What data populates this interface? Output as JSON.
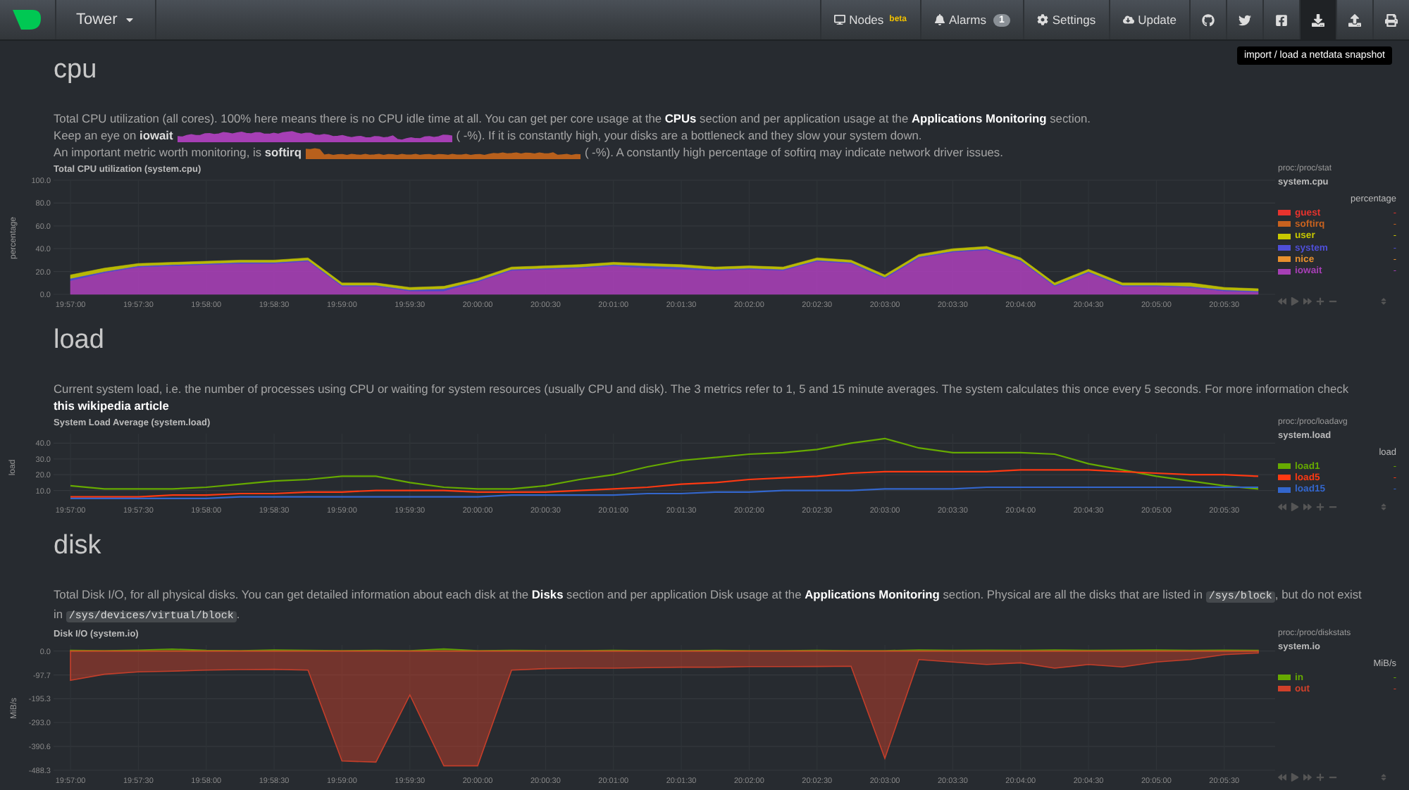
{
  "nav": {
    "host": "Tower",
    "items": [
      {
        "kind": "text",
        "label": "Nodes",
        "sup": "beta",
        "selected": false
      },
      {
        "kind": "text",
        "label": "Alarms",
        "count": "1",
        "selected": false
      },
      {
        "kind": "text",
        "label": "Settings",
        "selected": false
      },
      {
        "kind": "text",
        "label": "Update",
        "selected": false
      },
      {
        "kind": "icon",
        "selected": false
      },
      {
        "kind": "icon",
        "selected": false
      },
      {
        "kind": "icon",
        "selected": false
      },
      {
        "kind": "icon",
        "selected": true
      },
      {
        "kind": "icon",
        "selected": false
      },
      {
        "kind": "icon",
        "selected": false
      }
    ],
    "tooltip": "import / load a netdata snapshot"
  },
  "sections": [
    {
      "heading": "cpu",
      "description": [
        [
          {
            "kind": "text",
            "text": "Total CPU utilization (all cores). 100% here means there is no CPU idle time at all. You can get per core usage at the "
          },
          {
            "kind": "link",
            "text": "CPUs"
          },
          {
            "kind": "text",
            "text": " section and per application usage at the "
          },
          {
            "kind": "link",
            "text": "Applications Monitoring"
          },
          {
            "kind": "text",
            "text": " section."
          }
        ],
        [
          {
            "kind": "text",
            "text": "Keep an eye on **iowait**"
          },
          {
            "kind": "sparkline",
            "color": "#a63fb5"
          },
          {
            "kind": "text",
            "text": "( -%). If it is constantly high, your disks are a bottleneck and they slow your system down."
          }
        ],
        [
          {
            "kind": "text",
            "text": "An important metric worth monitoring, is **softirq**"
          },
          {
            "kind": "sparkline",
            "color": "#b8601c"
          },
          {
            "kind": "text",
            "text": "( -%). A constantly high percentage of softirq may indicate network driver issues."
          }
        ]
      ],
      "legend": {
        "source": "proc:/proc/stat",
        "context": "system.cpu",
        "units": "percentage",
        "values": [
          "-",
          "-",
          "-",
          "-",
          "-",
          "-"
        ]
      },
      "chart_data": {
        "type": "area",
        "stacked": true,
        "grid": true,
        "title": "Total CPU utilization (system.cpu)",
        "ylabel": "percentage",
        "categories": [
          "19:57:00",
          null,
          "19:57:30",
          null,
          "19:58:00",
          null,
          "19:58:30",
          null,
          "19:59:00",
          null,
          "19:59:30",
          null,
          "20:00:00",
          null,
          "20:00:30",
          null,
          "20:01:00",
          null,
          "20:01:30",
          null,
          "20:02:00",
          null,
          "20:02:30",
          null,
          "20:03:00",
          null,
          "20:03:30",
          null,
          "20:04:00",
          null,
          "20:04:30",
          null,
          "20:05:00",
          null,
          "20:05:30",
          null
        ],
        "ylim": [
          0,
          100
        ],
        "yticks": [
          {
            "value": 0,
            "label": "0.0"
          },
          {
            "value": 20,
            "label": "20.0"
          },
          {
            "value": 40,
            "label": "40.0"
          },
          {
            "value": 60,
            "label": "60.0"
          },
          {
            "value": 80,
            "label": "80.0"
          },
          {
            "value": 100,
            "label": "100.0"
          }
        ],
        "series": [
          {
            "name": "iowait",
            "color": "#a63fb5",
            "values": [
              12,
              19,
              24,
              25,
              26,
              27,
              27,
              29,
              7,
              7,
              3,
              3,
              11,
              21,
              22,
              23,
              25,
              23,
              22,
              21,
              22,
              21,
              29,
              27,
              14,
              32,
              37,
              39,
              29,
              7,
              19,
              7,
              7,
              6,
              3,
              2
            ]
          },
          {
            "name": "nice",
            "color": "#e8902d",
            "values": [
              null,
              null,
              null,
              null,
              null,
              null,
              null,
              null,
              null,
              null,
              null,
              null,
              null,
              null,
              null,
              null,
              null,
              null,
              null,
              null,
              null,
              null,
              null,
              null,
              null,
              null,
              null,
              null,
              null,
              null,
              null,
              null,
              null,
              null,
              null,
              null
            ]
          },
          {
            "name": "system",
            "color": "#4f4fd8",
            "values": [
              2,
              1,
              1,
              1,
              1,
              1,
              1,
              1,
              1,
              1,
              1,
              2,
              1,
              1,
              1,
              1,
              1,
              2,
              2,
              1,
              1,
              1,
              1,
              1,
              1,
              1,
              1,
              1,
              1,
              1,
              1,
              1,
              1,
              1,
              1,
              1
            ]
          },
          {
            "name": "user",
            "color": "#c8c800",
            "values": [
              3,
              3,
              2,
              2,
              2,
              2,
              2,
              2,
              2,
              2,
              2,
              2,
              2,
              2,
              2,
              2,
              2,
              2,
              2,
              2,
              2,
              2,
              2,
              2,
              2,
              2,
              2,
              2,
              2,
              2,
              2,
              2,
              2,
              3,
              2,
              2
            ]
          },
          {
            "name": "softirq",
            "color": "#c8621f",
            "values": [
              null,
              null,
              null,
              null,
              null,
              null,
              null,
              null,
              null,
              null,
              null,
              null,
              null,
              null,
              null,
              null,
              null,
              null,
              null,
              null,
              null,
              null,
              null,
              null,
              null,
              null,
              null,
              null,
              null,
              null,
              null,
              null,
              null,
              null,
              null,
              null
            ]
          },
          {
            "name": "guest",
            "color": "#e8332d",
            "values": [
              null,
              null,
              null,
              null,
              null,
              null,
              null,
              null,
              null,
              null,
              null,
              null,
              null,
              null,
              null,
              null,
              null,
              null,
              null,
              null,
              null,
              null,
              null,
              null,
              null,
              null,
              null,
              null,
              null,
              null,
              null,
              null,
              null,
              null,
              null,
              null
            ]
          }
        ]
      }
    },
    {
      "heading": "load",
      "description": [
        [
          {
            "kind": "text",
            "text": "Current system load, i.e. the number of processes using CPU or waiting for system resources (usually CPU and disk). The 3 metrics refer to 1, 5 and 15 minute averages. The system calculates this once every 5 seconds. For more information check "
          },
          {
            "kind": "link",
            "text": "this wikipedia article"
          }
        ]
      ],
      "legend": {
        "source": "proc:/proc/loadavg",
        "context": "system.load",
        "units": "load",
        "values": [
          "-",
          "-",
          "-"
        ]
      },
      "chart_data": {
        "type": "line",
        "grid": true,
        "title": "System Load Average (system.load)",
        "ylabel": "load",
        "categories": [
          "19:57:00",
          null,
          "19:57:30",
          null,
          "19:58:00",
          null,
          "19:58:30",
          null,
          "19:59:00",
          null,
          "19:59:30",
          null,
          "20:00:00",
          null,
          "20:00:30",
          null,
          "20:01:00",
          null,
          "20:01:30",
          null,
          "20:02:00",
          null,
          "20:02:30",
          null,
          "20:03:00",
          null,
          "20:03:30",
          null,
          "20:04:00",
          null,
          "20:04:30",
          null,
          "20:05:00",
          null,
          "20:05:30",
          null
        ],
        "ylim": [
          4,
          46
        ],
        "yticks": [
          {
            "value": 10,
            "label": "10.0"
          },
          {
            "value": 20,
            "label": "20.0"
          },
          {
            "value": 30,
            "label": "30.0"
          },
          {
            "value": 40,
            "label": "40.0"
          }
        ],
        "series": [
          {
            "name": "load1",
            "color": "#66aa00",
            "values": [
              13,
              11,
              11,
              11,
              12,
              14,
              16,
              17,
              19,
              19,
              15,
              12,
              11,
              11,
              13,
              17,
              20,
              25,
              29,
              31,
              33,
              34,
              36,
              40,
              43,
              37,
              34,
              34,
              34,
              33,
              27,
              23,
              19,
              16,
              13,
              11
            ]
          },
          {
            "name": "load5",
            "color": "#fe3912",
            "values": [
              6,
              6,
              6,
              7,
              7,
              8,
              8,
              9,
              9,
              10,
              10,
              10,
              9,
              9,
              9,
              10,
              11,
              12,
              14,
              15,
              17,
              18,
              19,
              21,
              22,
              22,
              22,
              22,
              23,
              23,
              23,
              22,
              21,
              20,
              20,
              19
            ]
          },
          {
            "name": "load15",
            "color": "#3366cc",
            "values": [
              5,
              5,
              5,
              5,
              5,
              6,
              6,
              6,
              6,
              6,
              6,
              6,
              6,
              7,
              7,
              7,
              7,
              8,
              8,
              9,
              9,
              10,
              10,
              10,
              11,
              11,
              11,
              12,
              12,
              12,
              12,
              12,
              12,
              12,
              12,
              12
            ]
          }
        ]
      }
    },
    {
      "heading": "disk",
      "description": [
        [
          {
            "kind": "text",
            "text": "Total Disk I/O, for all physical disks. You can get detailed information about each disk at the "
          },
          {
            "kind": "link",
            "text": "Disks"
          },
          {
            "kind": "text",
            "text": " section and per application Disk usage at the "
          },
          {
            "kind": "link",
            "text": "Applications Monitoring"
          },
          {
            "kind": "text",
            "text": " section. Physical are all the disks that are listed in "
          },
          {
            "kind": "code",
            "text": "/sys/block"
          },
          {
            "kind": "text",
            "text": ", but do not exist in "
          },
          {
            "kind": "code",
            "text": "/sys/devices/virtual/block"
          },
          {
            "kind": "text",
            "text": "."
          }
        ]
      ],
      "legend": {
        "source": "proc:/proc/diskstats",
        "context": "system.io",
        "units": "MiB/s",
        "values": [
          "-",
          "-"
        ]
      },
      "chart_data": {
        "type": "area",
        "stacked": false,
        "grid": true,
        "title": "Disk I/O (system.io)",
        "ylabel": "MiB/s",
        "categories": [
          "19:57:00",
          null,
          "19:57:30",
          null,
          "19:58:00",
          null,
          "19:58:30",
          null,
          "19:59:00",
          null,
          "19:59:30",
          null,
          "20:00:00",
          null,
          "20:00:30",
          null,
          "20:01:00",
          null,
          "20:01:30",
          null,
          "20:02:00",
          null,
          "20:02:30",
          null,
          "20:03:00",
          null,
          "20:03:30",
          null,
          "20:04:00",
          null,
          "20:04:30",
          null,
          "20:05:00",
          null,
          "20:05:30",
          null
        ],
        "ylim": [
          -488.3,
          25
        ],
        "yticks": [
          {
            "value": 0,
            "label": "0.0"
          },
          {
            "value": -97.7,
            "label": "-97.7"
          },
          {
            "value": -195.3,
            "label": "-195.3"
          },
          {
            "value": -293,
            "label": "-293.0"
          },
          {
            "value": -390.6,
            "label": "-390.6"
          },
          {
            "value": -488.3,
            "label": "-488.3"
          }
        ],
        "series": [
          {
            "name": "in",
            "color": "#66aa00",
            "values": [
              3,
              2,
              4,
              8,
              3,
              2,
              5,
              3,
              2,
              3,
              2,
              9,
              2,
              3,
              2,
              2,
              3,
              2,
              2,
              3,
              2,
              2,
              3,
              2,
              2,
              5,
              3,
              4,
              3,
              5,
              3,
              4,
              5,
              3,
              4,
              3
            ]
          },
          {
            "name": "out",
            "color": "#d0402a",
            "values": [
              -120,
              -95,
              -85,
              -82,
              -78,
              -76,
              -75,
              -78,
              -450,
              -455,
              -180,
              -470,
              -470,
              -78,
              -72,
              -70,
              -70,
              -68,
              -66,
              -66,
              -64,
              -64,
              -63,
              -62,
              -440,
              -35,
              -45,
              -55,
              -48,
              -70,
              -55,
              -65,
              -45,
              -35,
              -15,
              -8
            ]
          }
        ]
      }
    }
  ]
}
